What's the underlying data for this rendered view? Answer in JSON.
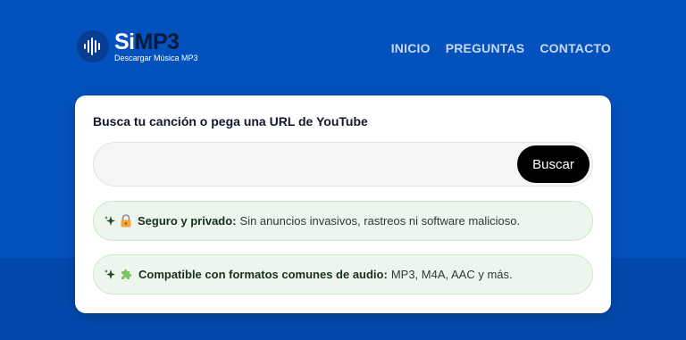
{
  "brand": {
    "name_part1": "Si",
    "name_part2": "MP3",
    "tagline": "Descargar Música MP3"
  },
  "nav": {
    "items": [
      {
        "label": "INICIO"
      },
      {
        "label": "PREGUNTAS"
      },
      {
        "label": "CONTACTO"
      }
    ]
  },
  "search": {
    "title": "Busca tu canción o pega una URL de YouTube",
    "placeholder": "",
    "value": "",
    "button_label": "Buscar"
  },
  "features": [
    {
      "icons": [
        "sparkles-icon",
        "lock-icon"
      ],
      "title": "Seguro y privado:",
      "text": "Sin anuncios invasivos, rastreos ni software malicioso."
    },
    {
      "icons": [
        "sparkles-icon",
        "puzzle-icon"
      ],
      "title": "Compatible con formatos comunes de audio:",
      "text": "MP3, M4A, AAC y más."
    }
  ],
  "colors": {
    "background": "#0351bd",
    "card": "#ffffff",
    "button": "#000000",
    "feature_bg": "#edf6ec",
    "nav_text": "#c8d8f5"
  }
}
